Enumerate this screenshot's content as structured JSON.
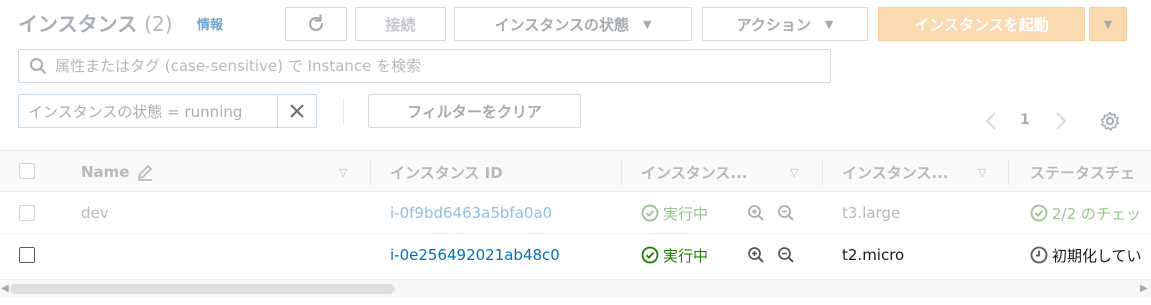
{
  "header": {
    "title": "インスタンス",
    "count": "(2)",
    "info_link": "情報",
    "connect_label": "接続",
    "instance_state_label": "インスタンスの状態",
    "actions_label": "アクション",
    "launch_label": "インスタンスを起動"
  },
  "search": {
    "placeholder": "属性またはタグ (case-sensitive) で Instance を検索"
  },
  "filter": {
    "token": "インスタンスの状態 = running",
    "clear_label": "フィルターをクリア"
  },
  "pagination": {
    "current_page": "1"
  },
  "table": {
    "columns": [
      "Name",
      "インスタンス ID",
      "インスタンス...",
      "インスタンス...",
      "ステータスチェ"
    ],
    "rows": [
      {
        "name": "dev",
        "instance_id": "i-0f9bd6463a5bfa0a0",
        "state": "実行中",
        "type": "t3.large",
        "status_check": "2/2 のチェッ"
      },
      {
        "name": "",
        "instance_id": "i-0e256492021ab48c0",
        "state": "実行中",
        "type": "t2.micro",
        "status_check": "初期化してい"
      }
    ]
  },
  "colors": {
    "link": "#0073bb",
    "running_green": "#1d8102",
    "launch_button": "#fbd9b1"
  }
}
